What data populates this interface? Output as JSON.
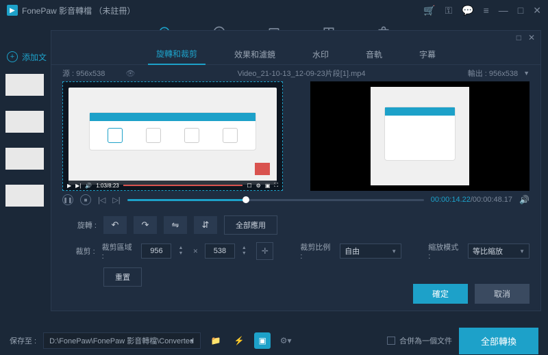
{
  "titlebar": {
    "app_name": "FonePaw 影音轉檔",
    "status": "（未註冊）"
  },
  "left": {
    "add_file": "添加文"
  },
  "editor": {
    "tabs": {
      "rotate_crop": "旋轉和裁剪",
      "effect_filter": "效果和濾鏡",
      "watermark": "水印",
      "audio": "音軌",
      "subtitle": "字幕"
    },
    "source_label": "源 : 956x538",
    "filename": "Video_21-10-13_12-09-23片段[1].mp4",
    "output_label": "輸出 : 956x538",
    "time_current": "00:00:14.22",
    "time_total": "/00:00:48.17",
    "rotate_label": "旋轉 :",
    "apply_all": "全部應用",
    "crop_label": "裁剪 :",
    "crop_area_label": "裁剪區域 :",
    "width": "956",
    "height": "538",
    "crop_ratio_label": "裁剪比例 :",
    "crop_ratio_value": "自由",
    "zoom_mode_label": "縮放模式 :",
    "zoom_mode_value": "等比縮放",
    "reset": "重置",
    "ok": "確定",
    "cancel": "取消"
  },
  "bottom": {
    "save_to": "保存至 :",
    "path": "D:\\FonePaw\\FonePaw 影音轉檔\\Converted",
    "merge": "合併為一個文件",
    "convert_all": "全部轉換"
  }
}
